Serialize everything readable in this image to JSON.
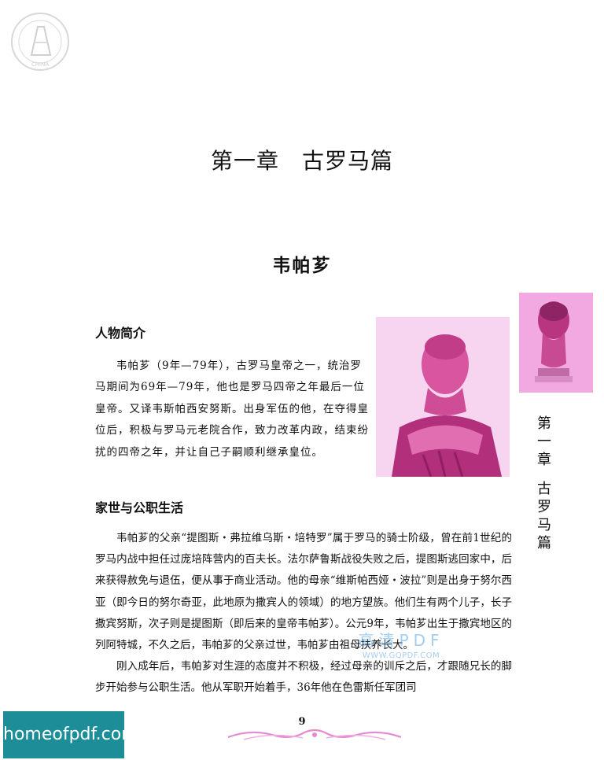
{
  "seal": {
    "text": "CHINA"
  },
  "chapter_title": "第一章　古罗马篇",
  "article_title": "韦帕芗",
  "side_tab": {
    "line1": [
      "第",
      "一",
      "章"
    ],
    "line2": [
      "古",
      "罗",
      "马",
      "篇"
    ]
  },
  "sections": {
    "intro_heading": "人物简介",
    "intro_text": "韦帕芗（9年—79年），古罗马皇帝之一，统治罗马期间为69年—79年，他也是罗马四帝之年最后一位皇帝。又译韦斯帕西安努斯。出身军伍的他，在夺得皇位后，积极与罗马元老院合作，致力改革内政，结束纷扰的四帝之年，并让自己子嗣顺利继承皇位。",
    "family_heading": "家世与公职生活",
    "paragraphs": [
      "韦帕芗的父亲“提图斯・弗拉维乌斯・培特罗”属于罗马的骑士阶级，曾在前1世纪的罗马内战中担任过庞培阵营内的百夫长。法尔萨鲁斯战役失败之后，提图斯逃回家中，后来获得赦免与退伍，便从事于商业活动。他的母亲“维斯帕西娅・波拉”则是出身于努尔西亚（即今日的努尔奇亚，此地原为撒宾人的领域）的地方望族。他们生有两个儿子，长子撒宾努斯，次子则是提图斯（即后来的皇帝韦帕芗）。公元9年，韦帕芗出生于撒宾地区的列阿特城，不久之后，韦帕芗的父亲过世，韦帕芗由祖母扶养长大。",
      "刚入成年后，韦帕芗对生涯的态度并不积极，经过母亲的训斥之后，才跟随兄长的脚步开始参与公职生活。他从军职开始着手，36年他在色雷斯任军团司"
    ]
  },
  "page_number": "9",
  "watermark": {
    "line1": "高清PDF",
    "line2": "WWW.GQPDF.COM"
  },
  "badge": "homeofpdf.com",
  "colors": {
    "accent_pink": "#e040b8",
    "badge_teal": "#1d8e98",
    "watermark_blue": "#5aa5e8"
  }
}
